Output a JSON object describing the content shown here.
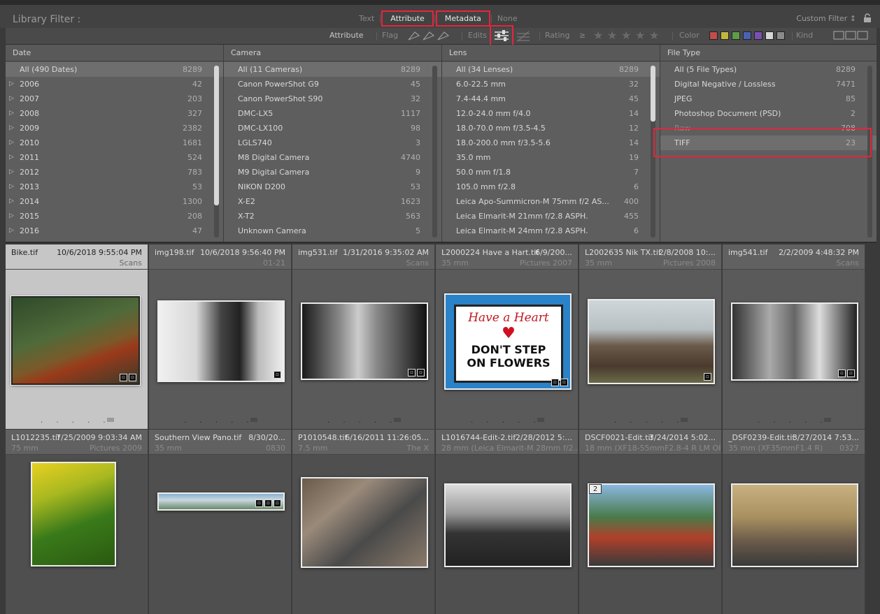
{
  "filterbar": {
    "title": "Library Filter :",
    "modes": [
      "Text",
      "Attribute",
      "Metadata",
      "None"
    ],
    "custom_filter": "Custom Filter ↕"
  },
  "attrbar": {
    "attribute": "Attribute",
    "flag": "Flag",
    "edits": "Edits",
    "rating": "Rating",
    "rating_op": "≥",
    "color": "Color",
    "kind": "Kind",
    "swatch_colors": [
      "#c24d4d",
      "#c2b63f",
      "#5f9c4a",
      "#4a62b4",
      "#7a4fb4",
      "#d6d6d6",
      "#8a8a8a"
    ]
  },
  "columns": [
    {
      "header": "Date",
      "rows": [
        {
          "label": "All (490 Dates)",
          "count": "8289"
        },
        {
          "label": "2006",
          "count": "42"
        },
        {
          "label": "2007",
          "count": "203"
        },
        {
          "label": "2008",
          "count": "327"
        },
        {
          "label": "2009",
          "count": "2382"
        },
        {
          "label": "2010",
          "count": "1681"
        },
        {
          "label": "2011",
          "count": "524"
        },
        {
          "label": "2012",
          "count": "783"
        },
        {
          "label": "2013",
          "count": "53"
        },
        {
          "label": "2014",
          "count": "1300"
        },
        {
          "label": "2015",
          "count": "208"
        },
        {
          "label": "2016",
          "count": "47"
        }
      ]
    },
    {
      "header": "Camera",
      "rows": [
        {
          "label": "All (11 Cameras)",
          "count": "8289"
        },
        {
          "label": "Canon PowerShot G9",
          "count": "45"
        },
        {
          "label": "Canon PowerShot S90",
          "count": "32"
        },
        {
          "label": "DMC-LX5",
          "count": "1117"
        },
        {
          "label": "DMC-LX100",
          "count": "98"
        },
        {
          "label": "LGLS740",
          "count": "3"
        },
        {
          "label": "M8 Digital Camera",
          "count": "4740"
        },
        {
          "label": "M9 Digital Camera",
          "count": "9"
        },
        {
          "label": "NIKON D200",
          "count": "53"
        },
        {
          "label": "X-E2",
          "count": "1623"
        },
        {
          "label": "X-T2",
          "count": "563"
        },
        {
          "label": "Unknown Camera",
          "count": "5"
        }
      ]
    },
    {
      "header": "Lens",
      "rows": [
        {
          "label": "All (34 Lenses)",
          "count": "8289"
        },
        {
          "label": "6.0-22.5 mm",
          "count": "32"
        },
        {
          "label": "7.4-44.4 mm",
          "count": "45"
        },
        {
          "label": "12.0-24.0 mm f/4.0",
          "count": "14"
        },
        {
          "label": "18.0-70.0 mm f/3.5-4.5",
          "count": "12"
        },
        {
          "label": "18.0-200.0 mm f/3.5-5.6",
          "count": "14"
        },
        {
          "label": "35.0 mm",
          "count": "19"
        },
        {
          "label": "50.0 mm f/1.8",
          "count": "7"
        },
        {
          "label": "105.0 mm f/2.8",
          "count": "6"
        },
        {
          "label": "Leica Apo-Summicron-M 75mm f/2 AS...",
          "count": "400"
        },
        {
          "label": "Leica Elmarit-M 21mm f/2.8 ASPH.",
          "count": "455"
        },
        {
          "label": "Leica Elmarit-M 24mm f/2.8 ASPH.",
          "count": "6"
        }
      ]
    },
    {
      "header": "File Type",
      "rows": [
        {
          "label": "All (5 File Types)",
          "count": "8289"
        },
        {
          "label": "Digital Negative / Lossless",
          "count": "7471"
        },
        {
          "label": "JPEG",
          "count": "85"
        },
        {
          "label": "Photoshop Document (PSD)",
          "count": "2"
        },
        {
          "label": "Raw",
          "count": "708"
        },
        {
          "label": "TIFF",
          "count": "23"
        }
      ]
    }
  ],
  "cells": [
    {
      "fn": "Bike.tif",
      "dt": "10/6/2018 9:55:04 PM",
      "s1": "",
      "s2": "Scans"
    },
    {
      "fn": "img198.tif",
      "dt": "10/6/2018 9:56:40 PM",
      "s1": "",
      "s2": "01-21"
    },
    {
      "fn": "img531.tif",
      "dt": "1/31/2016 9:35:02 AM",
      "s1": "",
      "s2": "Scans"
    },
    {
      "fn": "L2000224 Have a Hart.tif",
      "dt": "6/9/200...",
      "s1": "35 mm",
      "s2": "Pictures 2007"
    },
    {
      "fn": "L2002635 Nik TX.tif",
      "dt": "2/8/2008 10:...",
      "s1": "35 mm",
      "s2": "Pictures 2008"
    },
    {
      "fn": "img541.tif",
      "dt": "2/2/2009 4:48:32 PM",
      "s1": "",
      "s2": "Scans"
    },
    {
      "fn": "L1012235.tif",
      "dt": "7/25/2009 9:03:34 AM",
      "s1": "75 mm",
      "s2": "Pictures 2009"
    },
    {
      "fn": "Southern View Pano.tif",
      "dt": "8/30/20...",
      "s1": "35 mm",
      "s2": "0830"
    },
    {
      "fn": "P1010548.tif",
      "dt": "6/16/2011 11:26:05...",
      "s1": "7.5 mm",
      "s2": "The X"
    },
    {
      "fn": "L1016744-Edit-2.tif",
      "dt": "2/28/2012 5:...",
      "s1": "28 mm (Leica Elmarit-M 28mm f/2...",
      "s2": ""
    },
    {
      "fn": "DSCF0021-Edit.tif",
      "dt": "3/24/2014 5:02...",
      "s1": "18 mm (XF18-55mmF2.8-4 R LM OIS)",
      "s2": ""
    },
    {
      "fn": "_DSF0239-Edit.tif",
      "dt": "3/27/2014 7:53...",
      "s1": "35 mm (XF35mmF1.4 R)",
      "s2": "0327"
    }
  ],
  "sign": {
    "line1": "Have a Heart",
    "line2": "DON'T STEP",
    "line3": "ON FLOWERS"
  },
  "stack_count": "2",
  "dots": ". . . . ."
}
